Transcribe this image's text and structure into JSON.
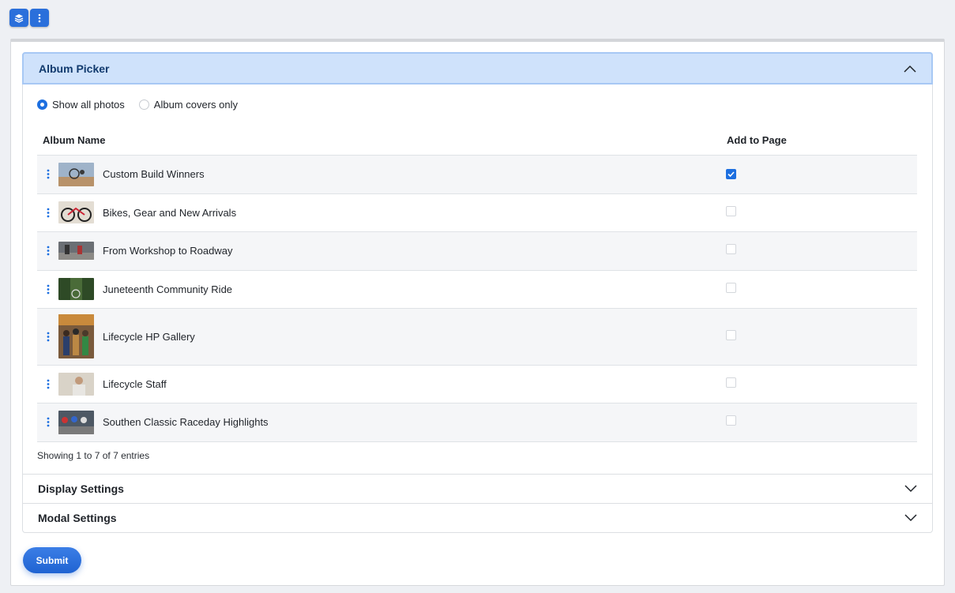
{
  "toolbar": {
    "icons": [
      "layers-icon",
      "more-vertical-icon"
    ]
  },
  "album_picker": {
    "title": "Album Picker",
    "radio_options": [
      {
        "label": "Show all photos",
        "checked": true
      },
      {
        "label": "Album covers only",
        "checked": false
      }
    ],
    "columns": [
      "Album Name",
      "Add to Page"
    ],
    "rows": [
      {
        "name": "Custom Build Winners",
        "added": true
      },
      {
        "name": "Bikes, Gear and New Arrivals",
        "added": false
      },
      {
        "name": "From Workshop to Roadway",
        "added": false
      },
      {
        "name": "Juneteenth Community Ride",
        "added": false
      },
      {
        "name": "Lifecycle HP Gallery",
        "added": false
      },
      {
        "name": "Lifecycle Staff",
        "added": false
      },
      {
        "name": "Southen Classic Raceday Highlights",
        "added": false
      }
    ],
    "entries_info": "Showing 1 to 7 of 7 entries"
  },
  "display_settings": {
    "title": "Display Settings"
  },
  "modal_settings": {
    "title": "Modal Settings"
  },
  "submit_label": "Submit",
  "colors": {
    "accent": "#1d6fe0",
    "header_bg": "#cfe2fb"
  }
}
